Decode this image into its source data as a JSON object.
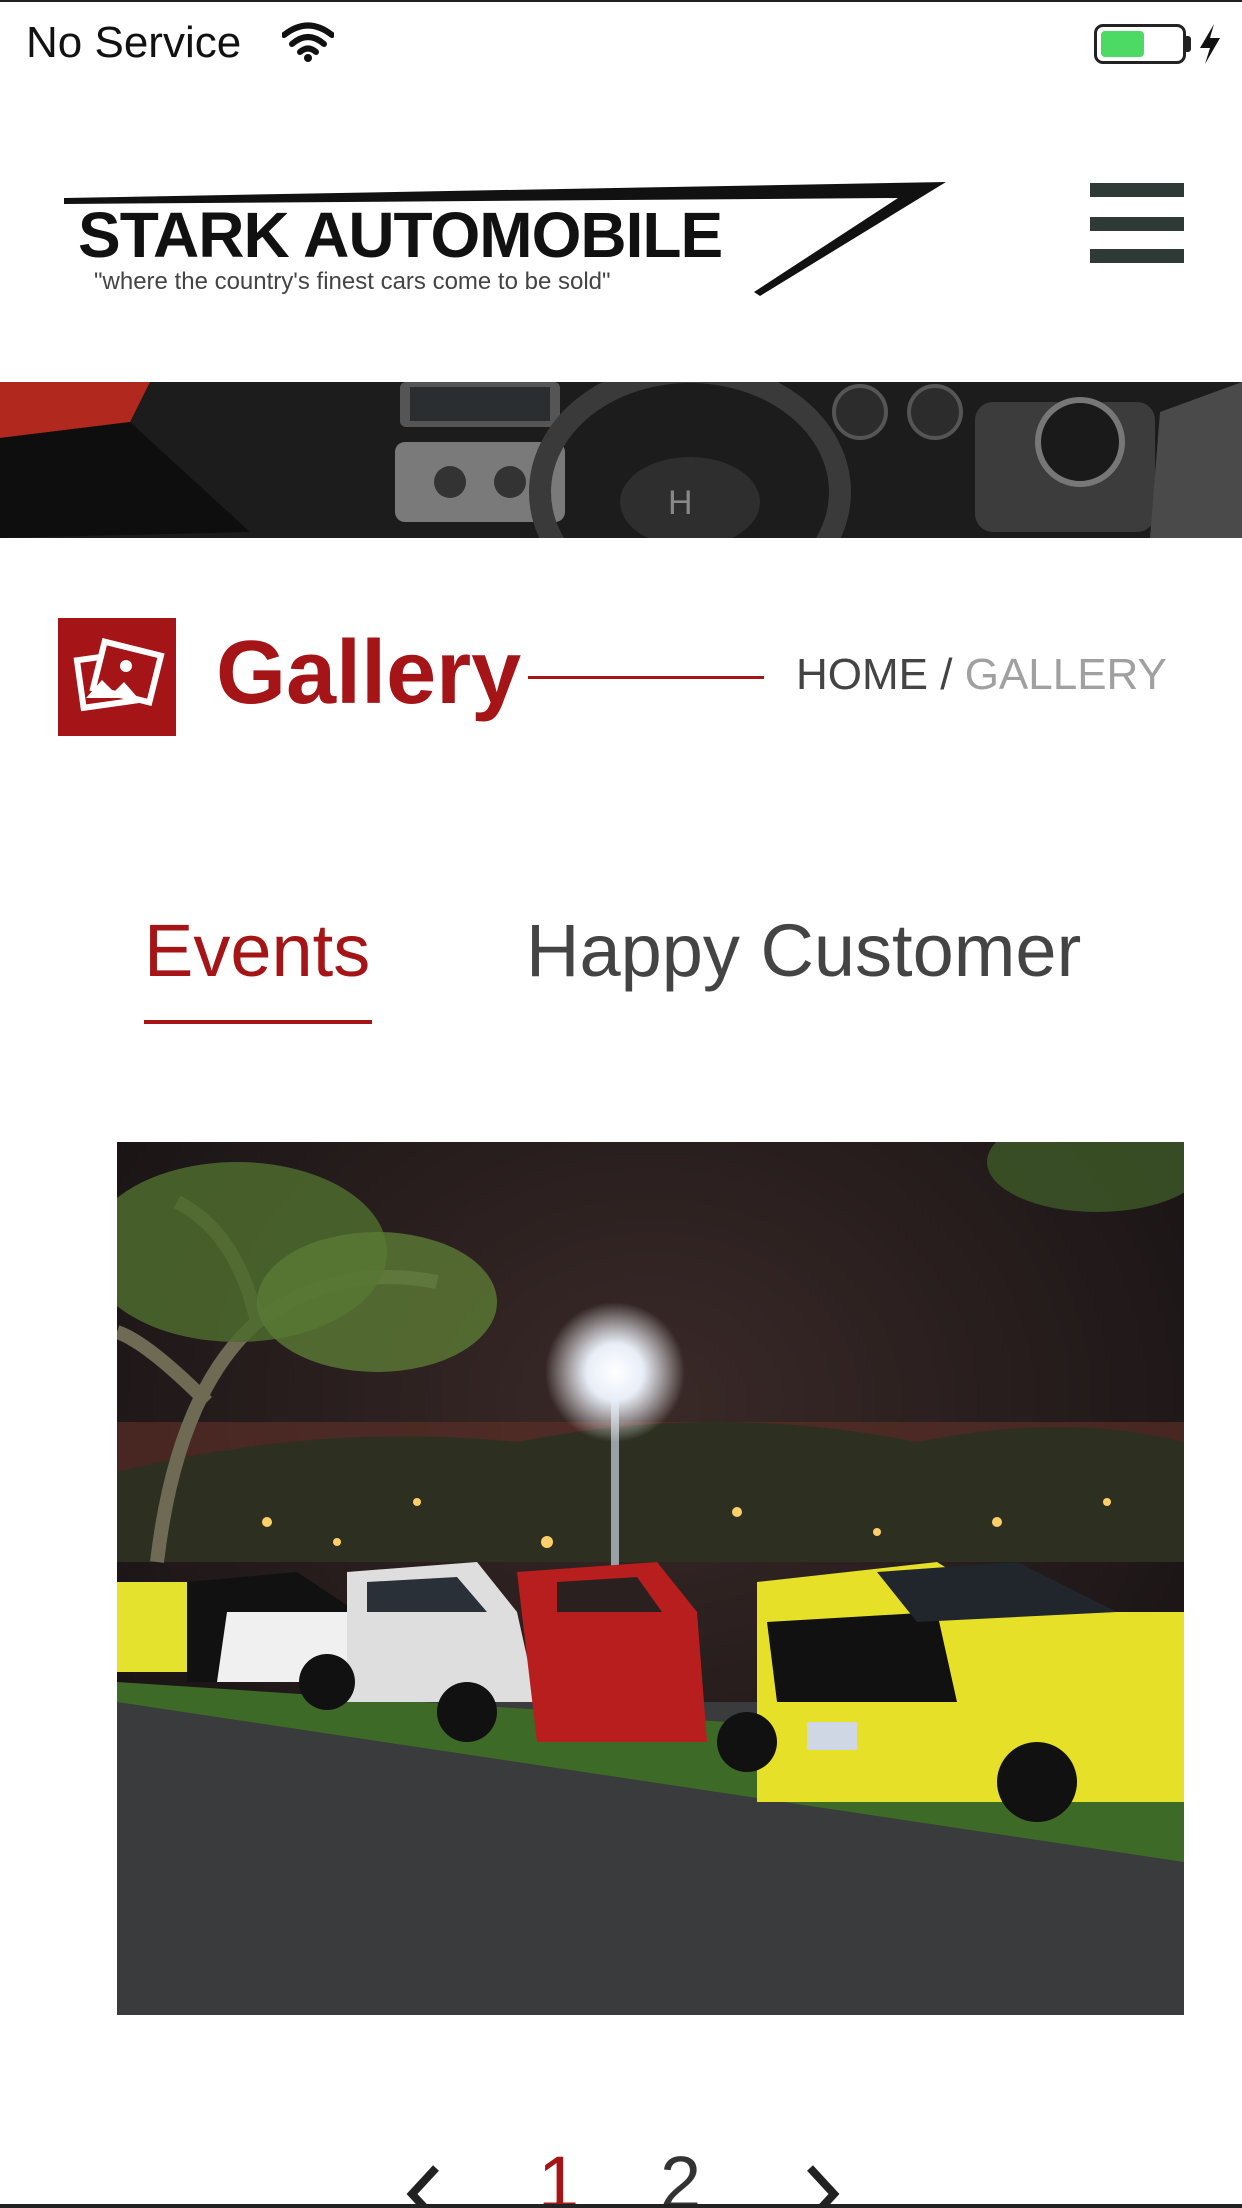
{
  "status_bar": {
    "carrier": "No Service",
    "battery_level": 0.55
  },
  "header": {
    "logo_title": "STARK AUTOMOBILE",
    "logo_tagline": "\"where the country's finest cars come to be sold\"",
    "menu_icon": "hamburger-menu-icon"
  },
  "page": {
    "title": "Gallery",
    "icon": "gallery-icon",
    "breadcrumb": {
      "home": "HOME",
      "separator": " / ",
      "current": "GALLERY"
    }
  },
  "tabs": [
    {
      "label": "Events",
      "active": true
    },
    {
      "label": "Happy Customer",
      "active": false
    }
  ],
  "pagination": {
    "pages": [
      "1",
      "2"
    ],
    "current": "1"
  },
  "colors": {
    "accent": "#a51416",
    "text": "#444444",
    "muted": "#a0a0a0"
  }
}
